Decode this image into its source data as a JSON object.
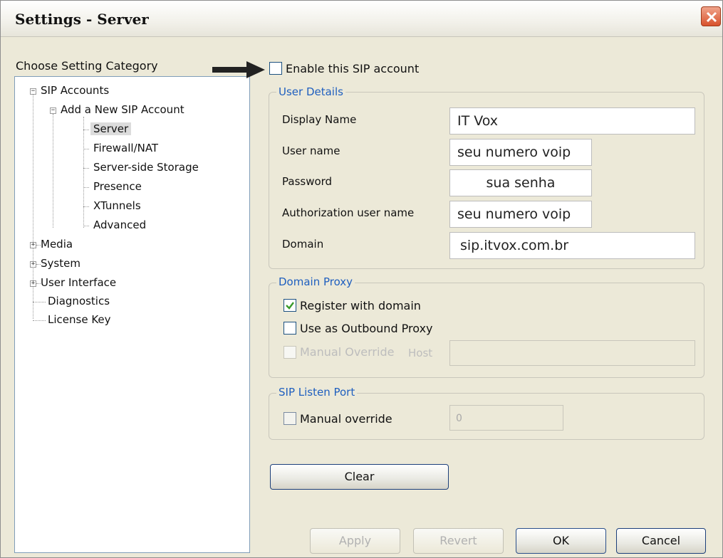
{
  "window": {
    "title": "Settings - Server"
  },
  "sidebar": {
    "label": "Choose Setting Category",
    "items": [
      {
        "label": "SIP Accounts"
      },
      {
        "label": "Add a New SIP Account"
      },
      {
        "label": "Server"
      },
      {
        "label": "Firewall/NAT"
      },
      {
        "label": "Server-side Storage"
      },
      {
        "label": "Presence"
      },
      {
        "label": "XTunnels"
      },
      {
        "label": "Advanced"
      },
      {
        "label": "Media"
      },
      {
        "label": "System"
      },
      {
        "label": "User Interface"
      },
      {
        "label": "Diagnostics"
      },
      {
        "label": "License Key"
      }
    ]
  },
  "enable_account": {
    "label": "Enable this SIP account",
    "checked": false
  },
  "user_details": {
    "legend": "User Details",
    "display_name": {
      "label": "Display Name",
      "value": "IT Vox"
    },
    "user_name": {
      "label": "User name",
      "value": "seu numero voip"
    },
    "password": {
      "label": "Password",
      "value": "sua senha"
    },
    "auth_user_name": {
      "label": "Authorization user name",
      "value": "seu numero voip"
    },
    "domain": {
      "label": "Domain",
      "value": "sip.itvox.com.br"
    }
  },
  "domain_proxy": {
    "legend": "Domain Proxy",
    "register_with_domain": {
      "label": "Register with domain",
      "checked": true
    },
    "outbound_proxy": {
      "label": "Use as Outbound Proxy",
      "checked": false
    },
    "manual_override": {
      "label": "Manual Override",
      "checked": false
    },
    "host_label": "Host",
    "host_value": ""
  },
  "listen_port": {
    "legend": "SIP Listen Port",
    "manual_override": {
      "label": "Manual override",
      "checked": false
    },
    "port_value": "0"
  },
  "buttons": {
    "clear": "Clear",
    "apply": "Apply",
    "revert": "Revert",
    "ok": "OK",
    "cancel": "Cancel"
  },
  "colors": {
    "legend": "#1f5fbf",
    "check": "#3a9a2a",
    "close": "#d8522c"
  }
}
